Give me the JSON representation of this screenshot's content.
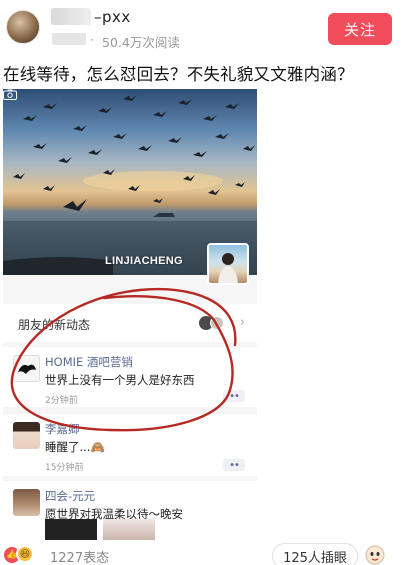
{
  "author": {
    "name_suffix": "–pxx",
    "read_count": "50.4万次阅读",
    "follow_label": "关注"
  },
  "question": "在线等待，怎么怼回去？不失礼貌又文雅内涵？",
  "screenshot": {
    "cover_username": "LINJIACHENG",
    "feed_label": "朋友的新动态",
    "feed_chevron": "›",
    "posts": [
      {
        "name": "HOMIE 酒吧营销",
        "text": "世界上没有一个男人是好东西",
        "time": "2分钟前",
        "more": "••"
      },
      {
        "name": "李嘉卿",
        "text": "睡醒了...🙈",
        "time": "15分钟前",
        "more": "••"
      },
      {
        "name": "四会-元元",
        "text": "愿世界对我温柔以待～晚安",
        "more": "••"
      }
    ]
  },
  "bottom": {
    "reactions_count": "1227表态",
    "comment_pill": "125人插眼"
  },
  "colors": {
    "follow_button": "#f24d5b",
    "link_name": "#5a6a93",
    "annotation_circle": "#b52a24"
  },
  "icons": [
    "camera-icon",
    "like-icon",
    "reaction-icon",
    "chevron-right-icon",
    "more-icon"
  ]
}
